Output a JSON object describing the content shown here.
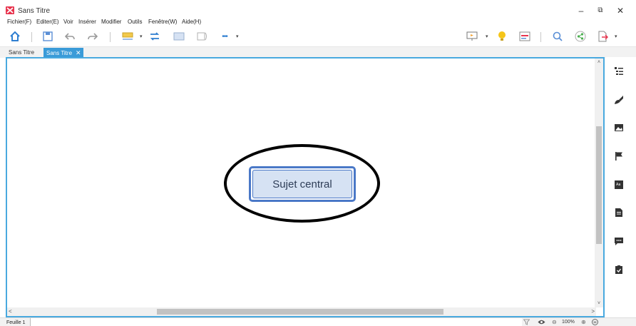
{
  "window": {
    "title": "Sans Titre",
    "minimize_glyph": "–",
    "maximize_glyph": "⧉",
    "close_glyph": "✕"
  },
  "menu": {
    "items": [
      "Fichier(F)",
      "Editer(E)",
      "Voir",
      "Insérer",
      "Modifier",
      "Outils",
      "Fenêtre(W)",
      "Aide(H)"
    ]
  },
  "toolbar": {
    "icons": [
      "home-icon",
      "save-icon",
      "undo-icon",
      "redo-icon",
      "topic-style-icon",
      "relationship-icon",
      "boundary-icon",
      "summary-icon",
      "more-icon",
      "presentation-icon",
      "idea-icon",
      "outline-icon",
      "search-icon",
      "share-icon",
      "export-icon"
    ],
    "more_glyph": "•••",
    "caret_glyph": "▾"
  },
  "tabs": [
    {
      "label": "Sans Titre",
      "active": false
    },
    {
      "label": "Sans Titre",
      "active": true,
      "close_glyph": "✕"
    }
  ],
  "canvas": {
    "central_topic": "Sujet central",
    "scroll_up": "˄",
    "scroll_down": "˅",
    "scroll_left": "<",
    "scroll_right": ">"
  },
  "side_panel": {
    "icons": [
      "outline-panel-icon",
      "format-brush-icon",
      "image-icon",
      "flag-icon",
      "text-style-icon",
      "notes-icon",
      "comment-icon",
      "task-icon"
    ]
  },
  "status": {
    "sheet_label": "Feuille 1",
    "zoom": "100%",
    "zoom_out_glyph": "⊖",
    "zoom_in_glyph": "⊕"
  },
  "colors": {
    "accent": "#3a9bd8",
    "topic_border": "#4a78c7",
    "topic_fill": "#d6e2f3",
    "logo": "#e8344e"
  }
}
